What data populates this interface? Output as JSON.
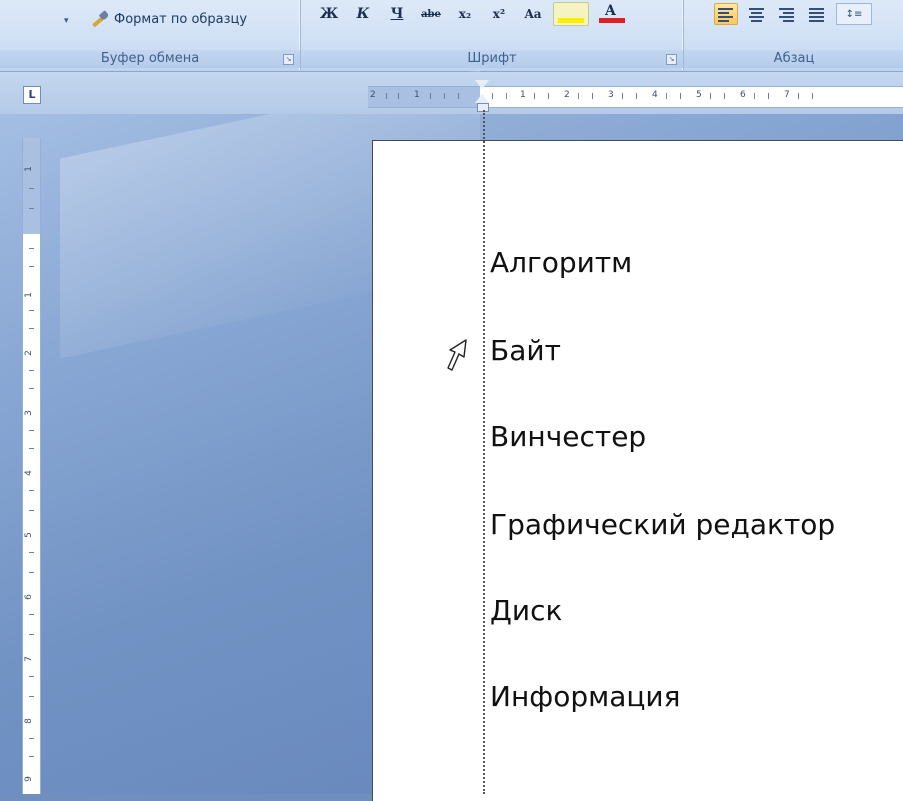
{
  "ribbon": {
    "clipboard": {
      "format_painter_label": "Формат по образцу",
      "group_label": "Буфер обмена"
    },
    "font": {
      "group_label": "Шрифт",
      "buttons": [
        "Ж",
        "К",
        "Ч",
        "abe",
        "x₂",
        "x²",
        "Aa"
      ],
      "highlight_color": "#ffee00",
      "font_color": "#e02020",
      "font_color_letter": "A"
    },
    "paragraph": {
      "group_label": "Абзац"
    }
  },
  "rulers": {
    "tab_selector_glyph": "L",
    "horizontal_numbers": [
      "2",
      "1",
      "1",
      "2",
      "3",
      "4",
      "5",
      "6",
      "7"
    ],
    "vertical_numbers": [
      "1",
      "1",
      "2",
      "3",
      "4",
      "5",
      "6",
      "7",
      "8",
      "9"
    ]
  },
  "document": {
    "terms": [
      "Алгоритм",
      "Байт",
      "Винчестер",
      "Графический редактор",
      "Диск",
      "Информация"
    ]
  },
  "icons": {
    "format_painter": "brush-icon",
    "launcher": "dialog-launcher-icon",
    "cursor": "move-arrow-cursor-icon"
  }
}
